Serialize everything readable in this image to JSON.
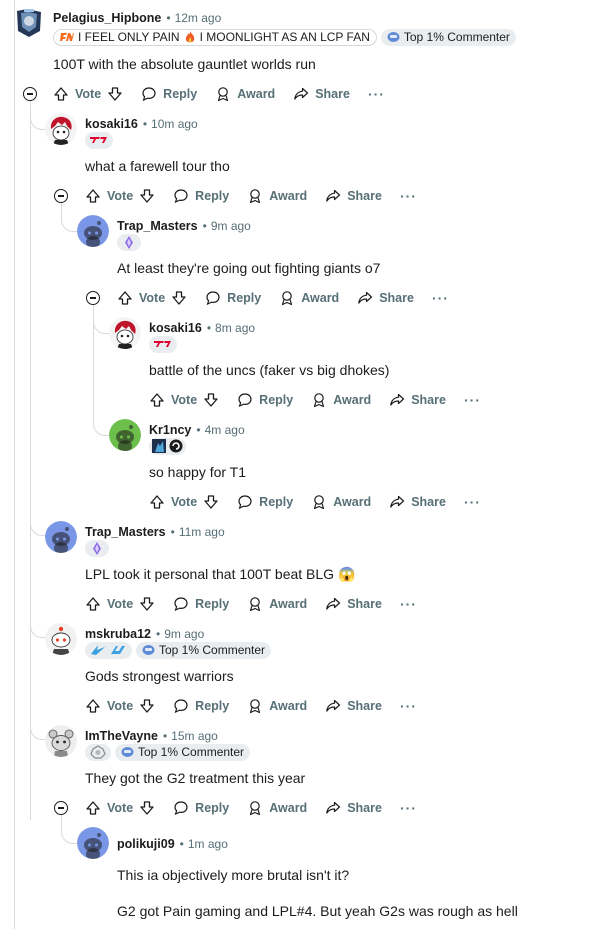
{
  "comments": [
    {
      "username": "Pelagius_Hipbone",
      "time": "12m ago",
      "flair_text": "I FEEL ONLY PAIN",
      "flair_text2": "I MOONLIGHT AS AN LCP FAN",
      "badge": "Top 1% Commenter",
      "body": "100T with the absolute gauntlet worlds run"
    },
    {
      "username": "kosaki16",
      "time": "10m ago",
      "body": "what a farewell tour tho"
    },
    {
      "username": "Trap_Masters",
      "time": "9m ago",
      "body": "At least they're going out fighting giants o7"
    },
    {
      "username": "kosaki16",
      "time": "8m ago",
      "body": "battle of the uncs (faker vs big dhokes)"
    },
    {
      "username": "Kr1ncy",
      "time": "4m ago",
      "body": "so happy for T1"
    },
    {
      "username": "Trap_Masters",
      "time": "11m ago",
      "body": "LPL took it personal that 100T beat BLG 😱"
    },
    {
      "username": "mskruba12",
      "time": "9m ago",
      "badge": "Top 1% Commenter",
      "body": "Gods strongest warriors"
    },
    {
      "username": "ImTheVayne",
      "time": "15m ago",
      "badge": "Top 1% Commenter",
      "body": "They got the G2 treatment this year"
    },
    {
      "username": "polikuji09",
      "time": "1m ago",
      "body": "This ia objectively more brutal isn't it?",
      "body2": "G2 got Pain gaming and LPL#4. But yeah G2s was rough as hell"
    }
  ],
  "actions": {
    "vote": "Vote",
    "reply": "Reply",
    "award": "Award",
    "share": "Share",
    "more": "···"
  },
  "separator": "•",
  "icons": [
    "upvote-icon",
    "downvote-icon",
    "reply-icon",
    "award-icon",
    "share-icon",
    "collapse-icon",
    "more-icon"
  ],
  "colors": {
    "text": "#1c1c1c",
    "meta": "#576f76",
    "thread_line": "#d8dadc",
    "badge_bg": "#eaedef",
    "snoo_blue": "#7a96e6",
    "snoo_green": "#6dbf4b",
    "t1_red": "#e2012d"
  }
}
